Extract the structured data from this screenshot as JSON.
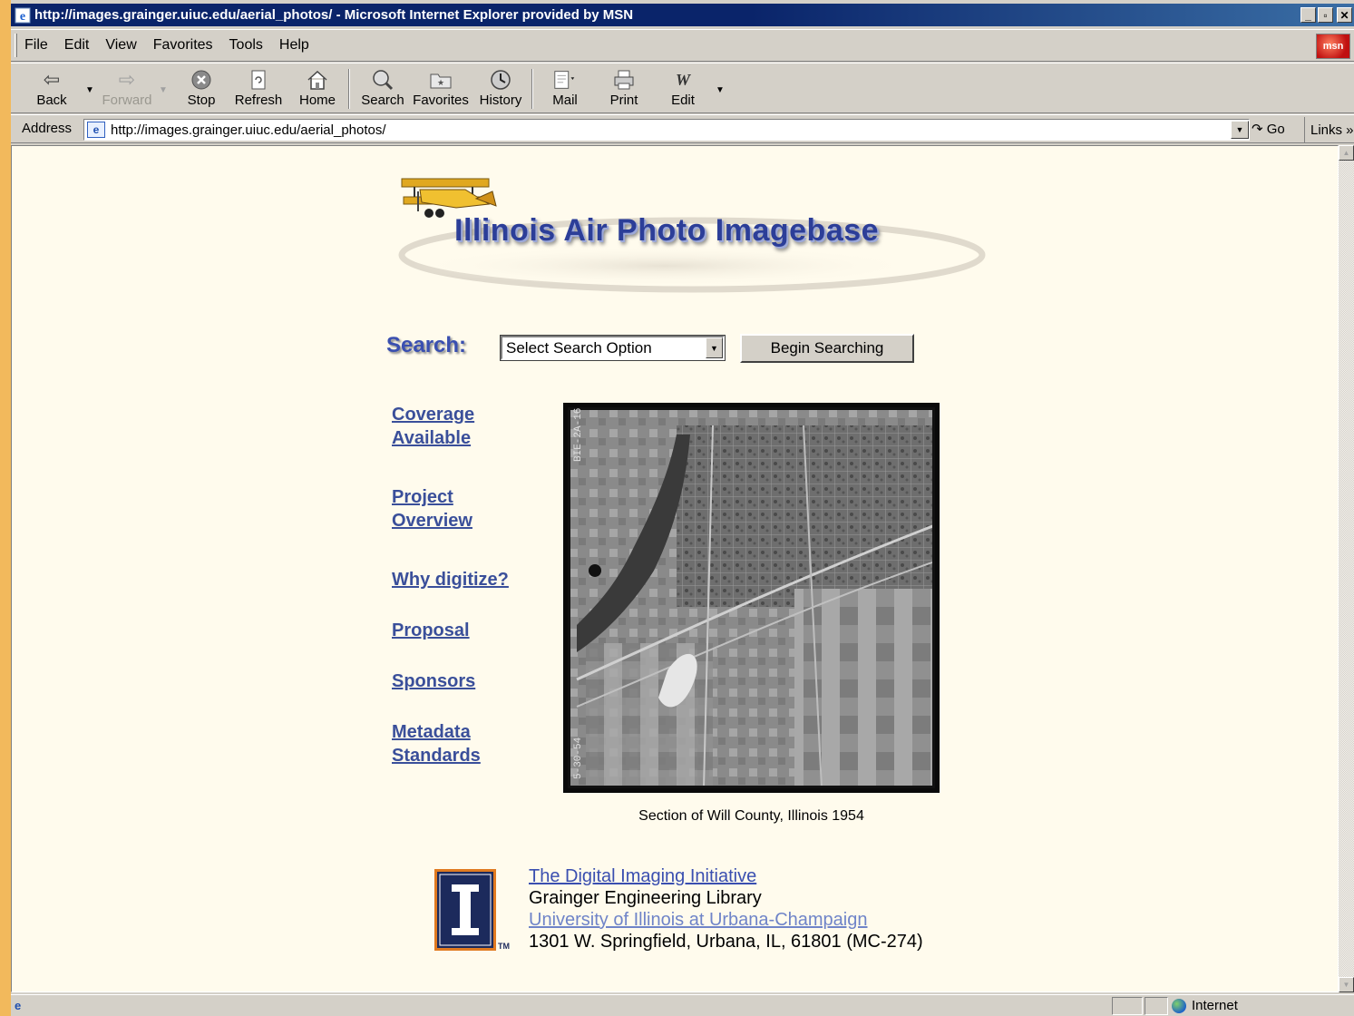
{
  "window": {
    "title": "http://images.grainger.uiuc.edu/aerial_photos/ - Microsoft Internet Explorer provided by MSN",
    "minimize": "_",
    "maximize": "▫",
    "close": "✕"
  },
  "menubar": {
    "items": [
      {
        "label": "File"
      },
      {
        "label": "Edit"
      },
      {
        "label": "View"
      },
      {
        "label": "Favorites"
      },
      {
        "label": "Tools"
      },
      {
        "label": "Help"
      }
    ],
    "brand": "msn"
  },
  "toolbar": {
    "back": "Back",
    "forward": "Forward",
    "stop": "Stop",
    "refresh": "Refresh",
    "home": "Home",
    "search": "Search",
    "favorites": "Favorites",
    "history": "History",
    "mail": "Mail",
    "print": "Print",
    "edit": "Edit"
  },
  "address": {
    "label": "Address",
    "url": "http://images.grainger.uiuc.edu/aerial_photos/",
    "go": "Go",
    "links": "Links »"
  },
  "page": {
    "banner_title": "Illinois Air Photo Imagebase",
    "search": {
      "label": "Search:",
      "select_value": "Select Search Option",
      "button": "Begin Searching"
    },
    "nav": [
      {
        "line1": "Coverage",
        "line2": "Available"
      },
      {
        "line1": "Project",
        "line2": "Overview"
      },
      {
        "line1": "Why digitize?"
      },
      {
        "line1": "Proposal"
      },
      {
        "line1": "Sponsors"
      },
      {
        "line1": "Metadata",
        "line2": "Standards"
      }
    ],
    "photo_caption": "Section of Will County, Illinois 1954",
    "photo_edge_text_top": "BIE-2A-16",
    "photo_edge_text_bottom": "5-30-54",
    "footer": {
      "line1": "The Digital Imaging Initiative",
      "line2": "Grainger Engineering Library",
      "line3": "University of Illinois at Urbana-Champaign",
      "line4": "1301 W. Springfield, Urbana, IL, 61801 (MC-274)",
      "tm": "TM"
    }
  },
  "status": {
    "zone": "Internet"
  },
  "colors": {
    "titlebar": "#0a246a",
    "page_bg": "#fffbed",
    "link": "#3a4f9a",
    "chrome": "#d4d0c8"
  }
}
